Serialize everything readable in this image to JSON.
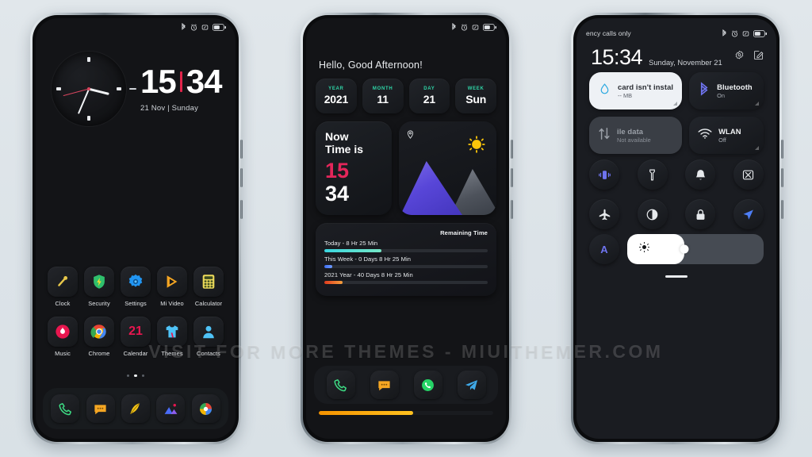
{
  "watermark": "VISIT FOR MORE THEMES - MIUITHEMER.COM",
  "colors": {
    "background": "#dee5e9",
    "screen": "#131417",
    "accent_red": "#e0244a",
    "accent_teal": "#2fd6a8",
    "accent_purple": "#5846d8",
    "accent_orange": "#f59300",
    "accent_blue": "#6f74f0"
  },
  "phone1": {
    "statusbar": {
      "left_text": "",
      "icons": [
        "bluetooth-icon",
        "alarm-icon",
        "vibrate-icon",
        "battery-icon"
      ]
    },
    "lockscreen": {
      "hours": "15",
      "minutes": "34",
      "date": "21 Nov | Sunday",
      "clock_widget": "analog-clock"
    },
    "apps_row1": [
      {
        "label": "Clock",
        "icon": "clock-app-icon"
      },
      {
        "label": "Security",
        "icon": "security-shield-icon"
      },
      {
        "label": "Settings",
        "icon": "settings-gear-icon"
      },
      {
        "label": "Mi Video",
        "icon": "mi-video-play-icon"
      },
      {
        "label": "Calculator",
        "icon": "calculator-icon"
      }
    ],
    "apps_row2": [
      {
        "label": "Music",
        "icon": "music-app-icon"
      },
      {
        "label": "Chrome",
        "icon": "chrome-icon"
      },
      {
        "label": "Calendar",
        "icon": "calendar-icon",
        "day": "21"
      },
      {
        "label": "Themes",
        "icon": "themes-shirt-icon"
      },
      {
        "label": "Contacts",
        "icon": "contacts-person-icon"
      }
    ],
    "page_dots": {
      "count": 3,
      "active_index": 1
    },
    "dock": [
      {
        "label": "Phone",
        "icon": "phone-handset-icon"
      },
      {
        "label": "Messages",
        "icon": "messages-bubble-icon"
      },
      {
        "label": "Notes",
        "icon": "notes-feather-icon"
      },
      {
        "label": "Gallery",
        "icon": "gallery-mountain-icon"
      },
      {
        "label": "Browser",
        "icon": "browser-color-wheel-icon"
      }
    ]
  },
  "phone2": {
    "statusbar": {
      "left_text": "",
      "icons": [
        "bluetooth-icon",
        "alarm-icon",
        "vibrate-icon",
        "battery-icon"
      ]
    },
    "greeting": "Hello, Good Afternoon!",
    "date_cards": [
      {
        "label": "YEAR",
        "value": "2021"
      },
      {
        "label": "MONTH",
        "value": "11"
      },
      {
        "label": "DAY",
        "value": "21"
      },
      {
        "label": "WEEK",
        "value": "Sun"
      }
    ],
    "now_widget": {
      "line1": "Now",
      "line2": "Time is",
      "hours": "15",
      "minutes": "34"
    },
    "photo_widget": {
      "icon": "location-pin-icon",
      "scene": "mountain-sun-illustration"
    },
    "remaining": {
      "title": "Remaining Time",
      "bars": [
        {
          "label": "Today - 8 Hr 25 Min",
          "percent": 35,
          "color_from": "#3ad6e0",
          "color_to": "#76e8c6"
        },
        {
          "label": "This Week - 0 Days 8 Hr 25 Min",
          "percent": 5,
          "color_from": "#3d6df0",
          "color_to": "#6f9bff"
        },
        {
          "label": "2021 Year - 40 Days 8 Hr 25 Min",
          "percent": 11,
          "color_from": "#e03a1e",
          "color_to": "#f5a03c"
        }
      ]
    },
    "dock": [
      {
        "label": "Phone",
        "icon": "phone-handset-icon"
      },
      {
        "label": "Messages",
        "icon": "messages-bubble-icon"
      },
      {
        "label": "WhatsApp",
        "icon": "whatsapp-icon"
      },
      {
        "label": "Telegram",
        "icon": "telegram-icon"
      }
    ],
    "bottom_bar": {
      "percent": 54
    }
  },
  "phone3": {
    "statusbar": {
      "left_text": "ency calls only",
      "icons": [
        "bluetooth-icon",
        "alarm-icon",
        "vibrate-icon",
        "battery-icon"
      ]
    },
    "clock": {
      "time": "15:34",
      "date": "Sunday, November 21"
    },
    "actions": [
      "settings-gear-icon",
      "edit-pencil-icon"
    ],
    "tiles": [
      {
        "name": "sim-storage",
        "title": "card isn't instal",
        "subtitle": "-- MB",
        "style": "light",
        "icon": "water-drop-icon"
      },
      {
        "name": "bluetooth",
        "title": "Bluetooth",
        "subtitle": "On",
        "style": "dark",
        "icon": "bluetooth-icon"
      },
      {
        "name": "mobile-data",
        "title": "ile data",
        "subtitle": "Not available",
        "style": "grey",
        "icon": "data-arrows-icon"
      },
      {
        "name": "wlan",
        "title": "WLAN",
        "subtitle": "Off",
        "style": "dark",
        "icon": "wifi-icon"
      }
    ],
    "circles_row1": [
      {
        "name": "vibrate",
        "icon": "vibrate-icon",
        "active": true
      },
      {
        "name": "flashlight",
        "icon": "flashlight-icon",
        "active": false
      },
      {
        "name": "do-not-disturb",
        "icon": "bell-icon",
        "active": false
      },
      {
        "name": "screenshot",
        "icon": "screenshot-icon",
        "active": false
      }
    ],
    "circles_row2": [
      {
        "name": "airplane-mode",
        "icon": "airplane-icon",
        "active": false
      },
      {
        "name": "dark-mode",
        "icon": "contrast-icon",
        "active": false
      },
      {
        "name": "lock",
        "icon": "lock-icon",
        "active": false
      },
      {
        "name": "location",
        "icon": "location-arrow-icon",
        "active": true
      }
    ],
    "brightness": {
      "auto_label": "A",
      "percent": 42,
      "icon": "brightness-sun-icon"
    }
  }
}
